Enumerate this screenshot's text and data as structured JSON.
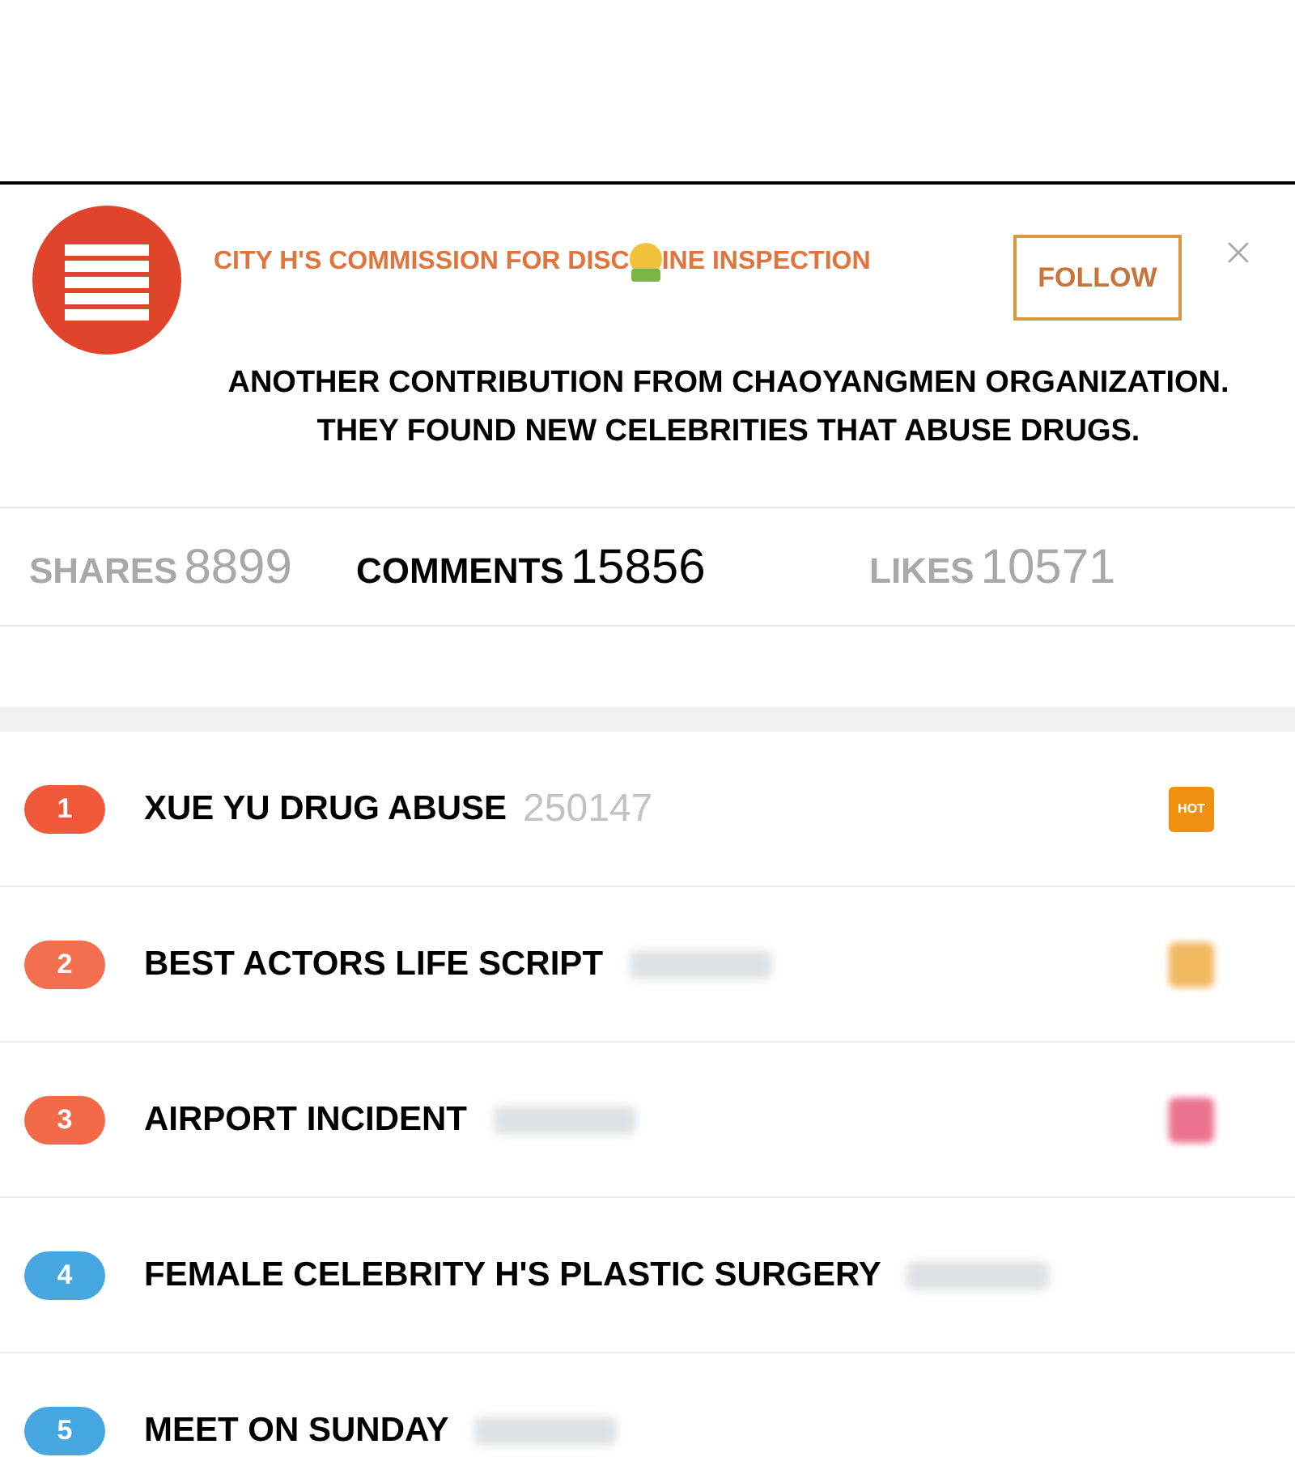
{
  "account": {
    "name_parts": [
      "CITY H'S COMMISSION FOR DISC",
      "INE INSPECTION"
    ],
    "follow_label": "FOLLOW"
  },
  "post": {
    "text": "ANOTHER CONTRIBUTION FROM CHAOYANGMEN ORGANIZATION. THEY FOUND NEW CELEBRITIES THAT ABUSE DRUGS."
  },
  "stats": [
    {
      "label": "SHARES",
      "count": "8899",
      "selected": false
    },
    {
      "label": "COMMENTS",
      "count": "15856",
      "selected": true
    },
    {
      "label": "LIKES",
      "count": "10571",
      "selected": false
    }
  ],
  "trending": [
    {
      "rank": "1",
      "color": "#f0583a",
      "title": "XUE YU DRUG ABUSE",
      "count": "250147",
      "count_blurred": false,
      "tag": {
        "label": "HOT",
        "color": "#ef9010",
        "blurred": false
      }
    },
    {
      "rank": "2",
      "color": "#f36f50",
      "title": "BEST ACTORS LIFE SCRIPT",
      "count_blurred": true,
      "tag": {
        "color": "#f2b862",
        "blurred": true
      }
    },
    {
      "rank": "3",
      "color": "#f36a48",
      "title": "AIRPORT INCIDENT",
      "count_blurred": true,
      "tag": {
        "color": "#ec7390",
        "blurred": true
      }
    },
    {
      "rank": "4",
      "color": "#45a6e0",
      "title": "FEMALE CELEBRITY H'S PLASTIC SURGERY",
      "count_blurred": true
    },
    {
      "rank": "5",
      "color": "#45a6e0",
      "title": "MEET ON SUNDAY",
      "count_blurred": true
    }
  ]
}
